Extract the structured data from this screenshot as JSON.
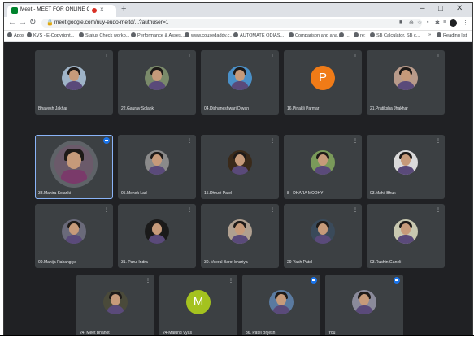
{
  "browser": {
    "tab_title": "Meet - MEET FOR ONLINE CLASS",
    "new_tab": "+",
    "close_tab": "×",
    "minimize": "–",
    "restore": "□",
    "close_window": "✕",
    "url": "meet.google.com/nuy-eudo-meltd/...?authuser=1",
    "bookmarks": [
      "Apps",
      "KVS - E-Copyright...",
      "Status Check workb...",
      "Performance & Asses...",
      "www.cousedaddy.c...",
      "AUTOMATE ODIAS...",
      "Comparison and ana...",
      "...",
      "re:",
      "SB Calculator, SB c...",
      "»",
      "Reading list"
    ]
  },
  "meet": {
    "participants": [
      {
        "name": "Bhavesh Jakhar",
        "avatar": "photo-avatar",
        "tint": "#9fb4c8"
      },
      {
        "name": "22.Gaurav Solanki",
        "avatar": "photo-avatar",
        "tint": "#7a8a6a"
      },
      {
        "name": "04.Dishaneshwari Diwan",
        "avatar": "photo-avatar",
        "tint": "#4a90c8"
      },
      {
        "name": "16.Pinakli Parmar",
        "avatar": "letter-avatar",
        "letter": "P",
        "tint": "#f07b17"
      },
      {
        "name": "21.Pratiksha Jhakhar",
        "avatar": "photo-avatar",
        "tint": "#b89a8a"
      },
      {
        "name": "38.Mahira Solanki",
        "avatar": "photo-avatar",
        "tint": "#6b5a6a",
        "speaking": true
      },
      {
        "name": "05.Mehek Lad",
        "avatar": "photo-avatar",
        "tint": "#8a8a8a"
      },
      {
        "name": "15.Dhruvi Patel",
        "avatar": "photo-avatar",
        "tint": "#3a2a1a"
      },
      {
        "name": "8 - DHARA MODHY",
        "avatar": "photo-avatar",
        "tint": "#7a9a5a"
      },
      {
        "name": "03.Mahil Bhuk",
        "avatar": "photo-avatar",
        "tint": "#dadada"
      },
      {
        "name": "09.Mahija Rahangiya",
        "avatar": "photo-avatar",
        "tint": "#6a6a7a"
      },
      {
        "name": "31. Parul Indra",
        "avatar": "photo-avatar",
        "tint": "#1a1a1a"
      },
      {
        "name": "30. Veeral Barot bhariya",
        "avatar": "photo-avatar",
        "tint": "#b0a090"
      },
      {
        "name": "29-Yash Patel",
        "avatar": "photo-avatar",
        "tint": "#3a4a5a"
      },
      {
        "name": "03.Rushin Ganeli",
        "avatar": "photo-avatar",
        "tint": "#c8c8b0"
      },
      {
        "name": "24. Meet Bhanot",
        "avatar": "photo-avatar",
        "tint": "#4a4a3a"
      },
      {
        "name": "24-Malund Vyas",
        "avatar": "letter-avatar",
        "letter": "M",
        "tint": "#a4c21f"
      },
      {
        "name": "36. Patel Brijesh",
        "avatar": "photo-avatar",
        "tint": "#5a7aa0",
        "speaking": true
      },
      {
        "name": "You",
        "avatar": "photo-avatar",
        "tint": "#8a8a9a",
        "speaking": true
      }
    ]
  }
}
